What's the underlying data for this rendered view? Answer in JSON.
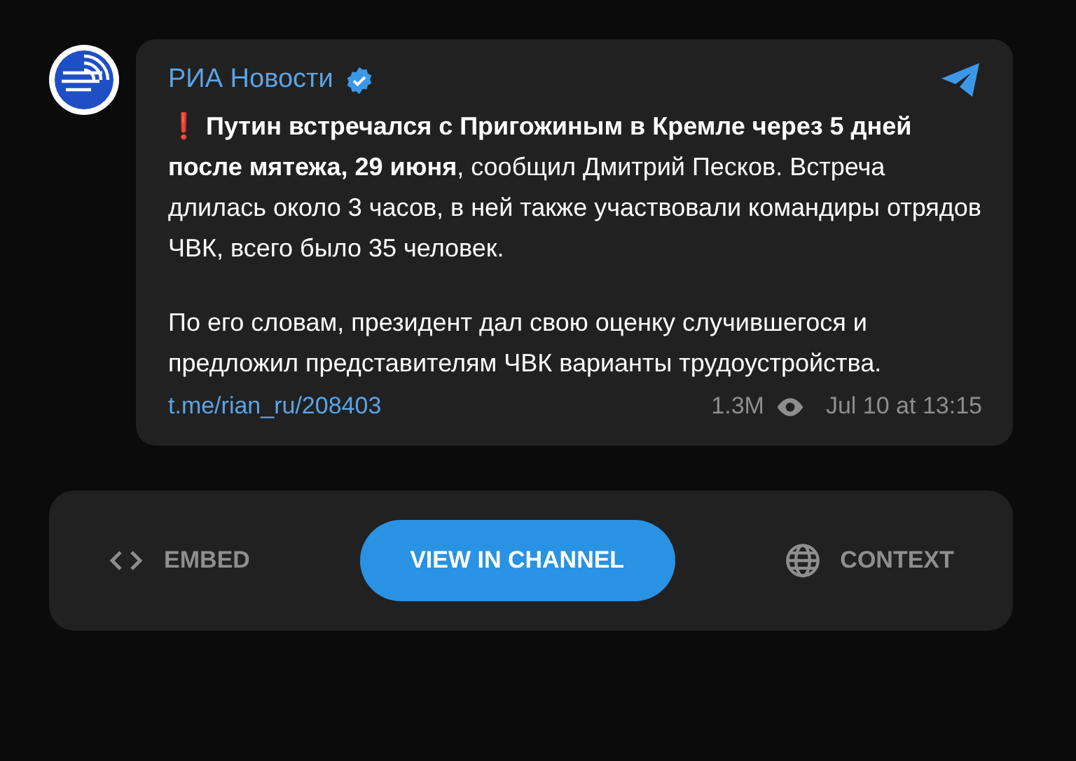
{
  "channel": {
    "name": "РИА Новости",
    "verified": true
  },
  "message": {
    "paragraphs": [
      "❗ **Путин встречался с Пригожиным в Кремле через 5 дней после мятежа, 29 июня**, сообщил Дмитрий Песков. Встреча длилась около 3 часов, в ней также участвовали командиры отрядов ЧВК, всего было 35 человек.",
      "По его словам, президент дал свою оценку случившегося и предложил представителям ЧВК варианты трудоустройства."
    ],
    "link": "t.me/rian_ru/208403",
    "views": "1.3M",
    "date": "Jul 10 at 13:15"
  },
  "actions": [
    {
      "kind": "code",
      "label": "EMBED"
    },
    {
      "kind": "primary",
      "label": "VIEW IN CHANNEL"
    },
    {
      "kind": "globe",
      "label": "CONTEXT"
    }
  ]
}
